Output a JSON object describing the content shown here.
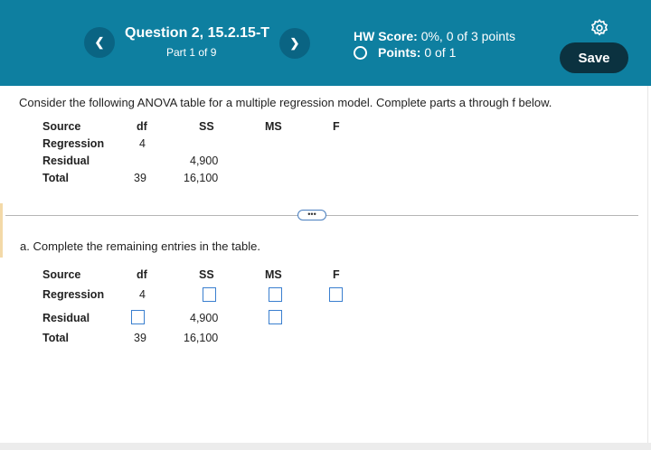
{
  "header": {
    "question_title": "Question 2, 15.2.15-T",
    "part_label": "Part 1 of 9",
    "hw_score_label": "HW Score:",
    "hw_score_value": "0%, 0 of 3 points",
    "points_label": "Points:",
    "points_value": "0 of 1",
    "save_label": "Save",
    "prev_icon": "chevron-left-icon",
    "next_icon": "chevron-right-icon",
    "settings_icon": "gear-icon"
  },
  "question": {
    "intro": "Consider the following ANOVA table for a multiple regression model. Complete parts a through f below.",
    "headers": {
      "source": "Source",
      "df": "df",
      "ss": "SS",
      "ms": "MS",
      "f": "F"
    },
    "rows": [
      {
        "source": "Regression",
        "df": "4",
        "ss": ""
      },
      {
        "source": "Residual",
        "df": "",
        "ss": "4,900"
      },
      {
        "source": "Total",
        "df": "39",
        "ss": "16,100"
      }
    ],
    "more_label": "•••"
  },
  "part_a": {
    "prompt": "a. Complete the remaining entries in the table.",
    "headers": {
      "source": "Source",
      "df": "df",
      "ss": "SS",
      "ms": "MS",
      "f": "F"
    },
    "rows": [
      {
        "source": "Regression",
        "df": "4",
        "ss": ""
      },
      {
        "source": "Residual",
        "df": "",
        "ss": "4,900"
      },
      {
        "source": "Total",
        "df": "39",
        "ss": "16,100"
      }
    ]
  }
}
